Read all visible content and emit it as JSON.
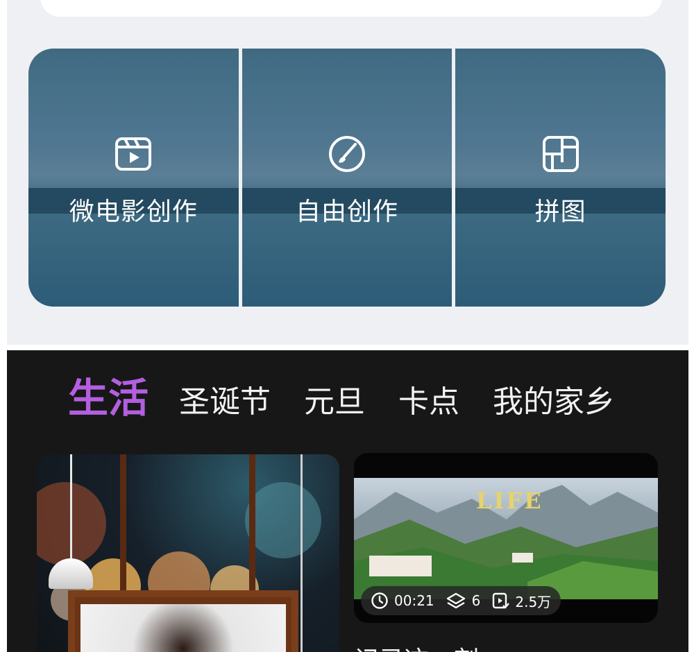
{
  "creation_tiles": [
    {
      "label": "微电影创作",
      "icon": "film-icon"
    },
    {
      "label": "自由创作",
      "icon": "brush-circle-icon"
    },
    {
      "label": "拼图",
      "icon": "collage-icon"
    }
  ],
  "category_tabs": [
    {
      "label": "生活",
      "active": true
    },
    {
      "label": "圣诞节",
      "active": false
    },
    {
      "label": "元旦",
      "active": false
    },
    {
      "label": "卡点",
      "active": false
    },
    {
      "label": "我的家乡",
      "active": false
    }
  ],
  "template_cards": {
    "left": {
      "description_icon": "photo-frame-template"
    },
    "right": {
      "title_art": "LIFE",
      "duration": "00:21",
      "clips": "6",
      "uses": "2.5万",
      "caption": "记录这一刻"
    }
  },
  "colors": {
    "active_tab": "#b35fe0",
    "dark_bg": "#171717",
    "light_bg": "#eef0f3"
  }
}
